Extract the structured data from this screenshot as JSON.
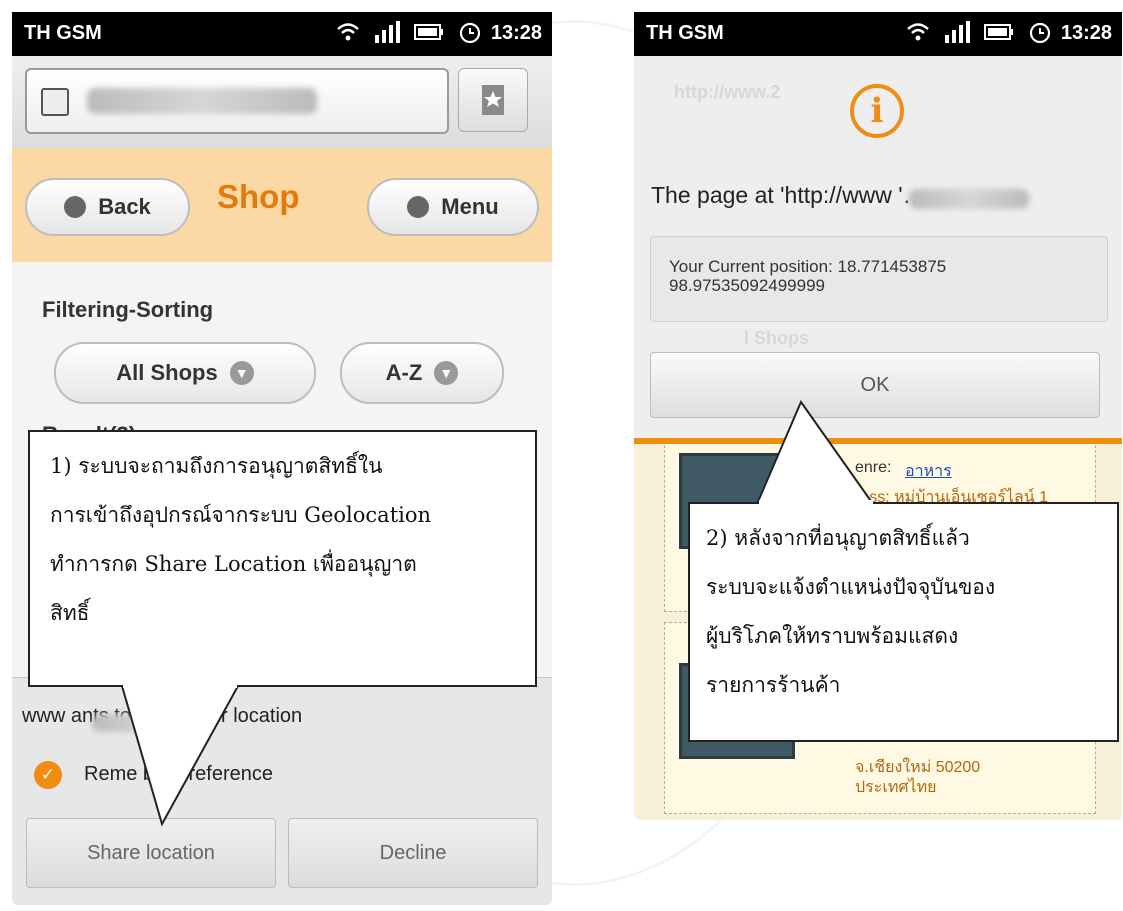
{
  "left_phone": {
    "status": {
      "carrier": "TH GSM",
      "time": "13:28"
    },
    "header": {
      "back": "Back",
      "title": "Shop",
      "menu": "Menu"
    },
    "filter": {
      "title": "Filtering-Sorting",
      "shops_select": "All Shops",
      "sort_select": "A-Z"
    },
    "result": "Result(3)",
    "callout": {
      "lines": [
        "1)    ระบบจะถามถึงการอนุญาตสิทธิ์ใน",
        "การเข้าถึงอุปกรณ์จากระบบ Geolocation",
        "ทำการกด Share   Location   เพื่ออนุญาต",
        "สิทธิ์"
      ]
    },
    "prompt": {
      "text": "www                    ants to know your location",
      "remember": "Reme    ber preference",
      "share": "Share location",
      "decline": "Decline"
    }
  },
  "right_phone": {
    "status": {
      "carrier": "TH GSM",
      "time": "13:28"
    },
    "dialog": {
      "title": "The page at 'http://www                   '…",
      "message_line1": "Your Current position: 18.771453875",
      "message_line2": "98.97535092499999",
      "ok": "OK"
    },
    "background": {
      "ghost_url": "http://www.2",
      "ghost_tab": "l Shops",
      "genre_label": "enre:",
      "genre_value": "อาหาร",
      "address_line": "ress: หมู่บ้านเอ็นเซอร์ไลน์ 1",
      "province": "จ.เชียงใหม่ 50200",
      "country": "ประเทศไทย"
    },
    "callout": {
      "lines": [
        "2)         หลังจากที่อนุญาตสิทธิ์แล้ว",
        "ระบบจะแจ้งตำแหน่งปัจจุบันของ",
        "ผู้บริโภคให้ทราบพร้อมแสดง",
        "รายการร้านค้า"
      ]
    }
  },
  "colors": {
    "accent": "#f08c10",
    "header_bg": "#fcd8a5",
    "shop_title": "#e07b10",
    "statusbar": "#000000"
  },
  "icons": [
    "wifi-icon",
    "signal-icon",
    "battery-icon",
    "alarm-icon",
    "globe-icon",
    "bookmark-star-icon",
    "back-arrow-icon",
    "menu-grid-icon",
    "chevron-down-icon",
    "checkmark-icon",
    "info-icon"
  ]
}
